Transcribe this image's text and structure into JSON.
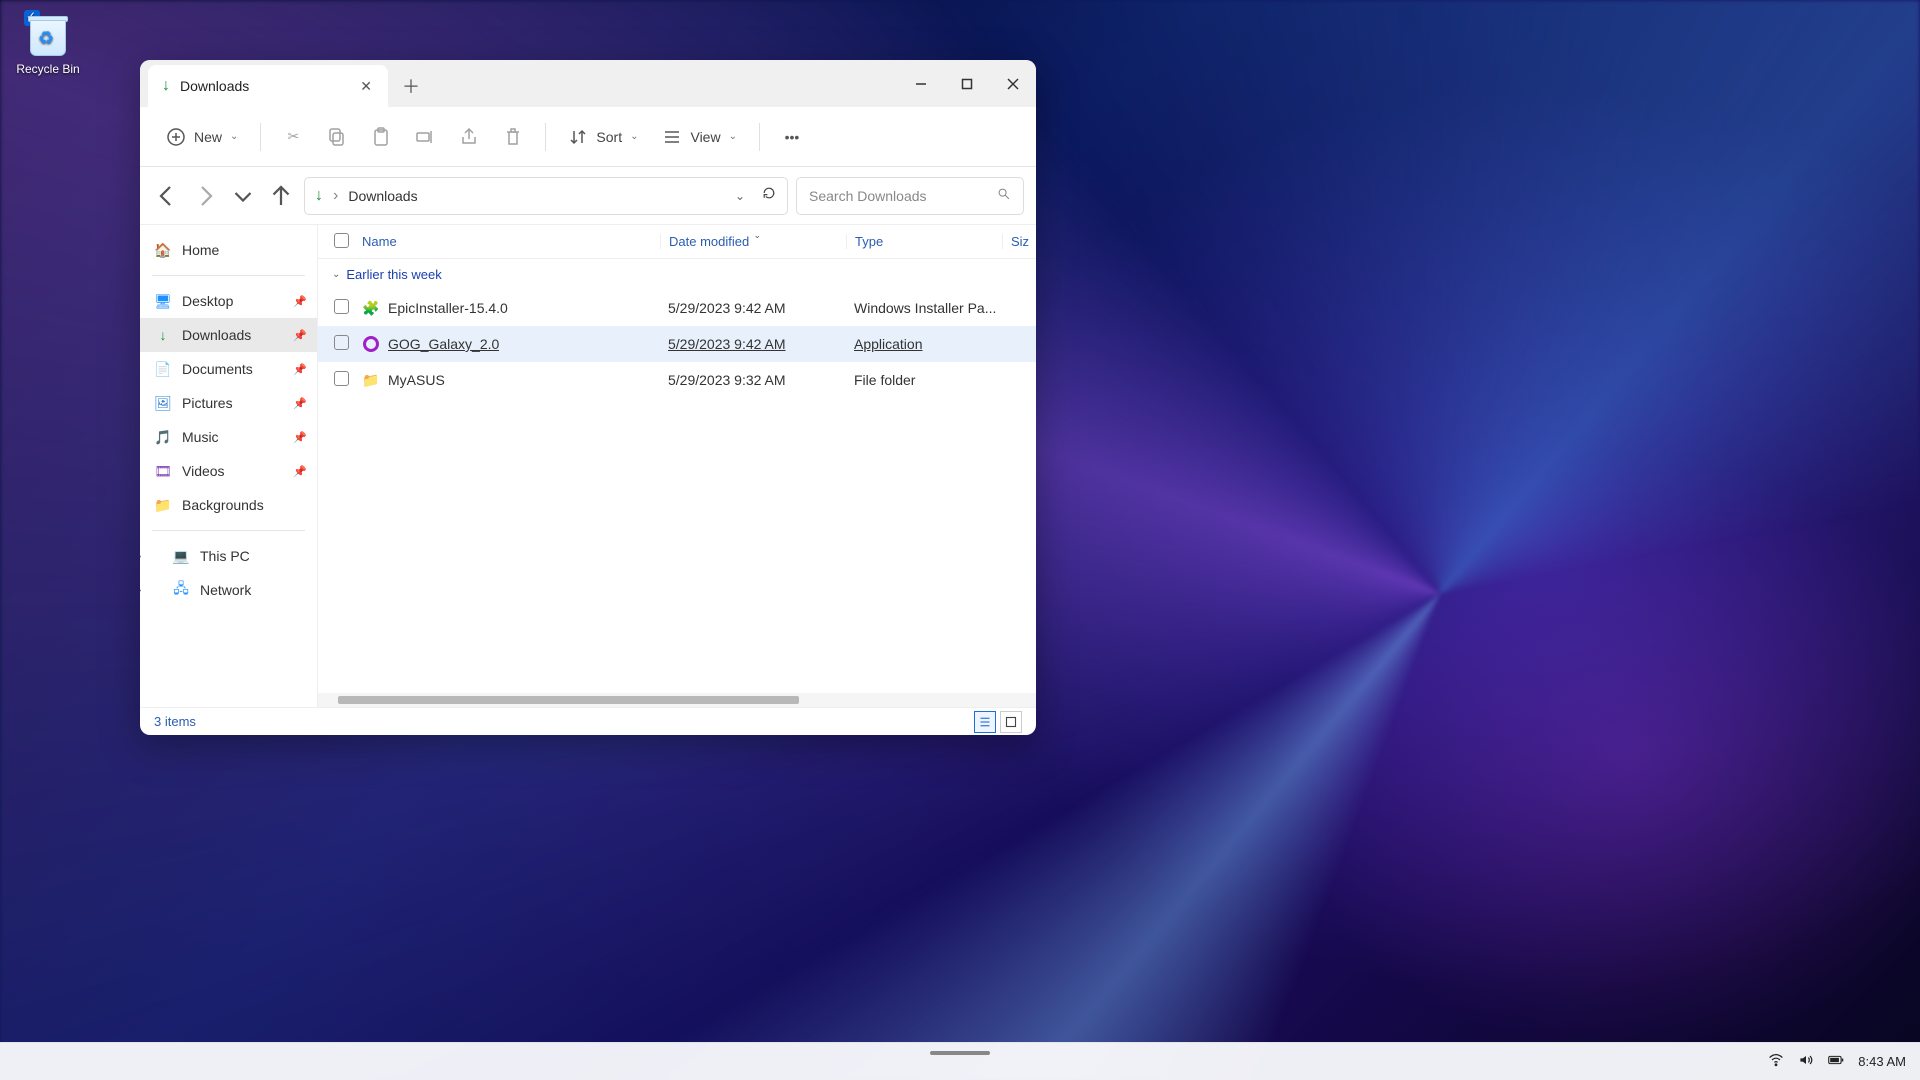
{
  "desktop": {
    "recycle_bin": "Recycle Bin"
  },
  "window": {
    "tab_title": "Downloads",
    "toolbar": {
      "new": "New",
      "sort": "Sort",
      "view": "View"
    },
    "address": {
      "location": "Downloads"
    },
    "search": {
      "placeholder": "Search Downloads"
    },
    "sidebar": {
      "home": "Home",
      "desktop": "Desktop",
      "downloads": "Downloads",
      "documents": "Documents",
      "pictures": "Pictures",
      "music": "Music",
      "videos": "Videos",
      "backgrounds": "Backgrounds",
      "this_pc": "This PC",
      "network": "Network"
    },
    "columns": {
      "name": "Name",
      "date": "Date modified",
      "type": "Type",
      "size": "Siz"
    },
    "group": "Earlier this week",
    "files": [
      {
        "name": "EpicInstaller-15.4.0",
        "date": "5/29/2023 9:42 AM",
        "type": "Windows Installer Pa...",
        "icon": "installer"
      },
      {
        "name": "GOG_Galaxy_2.0",
        "date": "5/29/2023 9:42 AM",
        "type": "Application",
        "icon": "gog",
        "hover": true
      },
      {
        "name": "MyASUS",
        "date": "5/29/2023 9:32 AM",
        "type": "File folder",
        "icon": "folder"
      }
    ],
    "status": "3 items"
  },
  "taskbar": {
    "clock": "8:43 AM"
  }
}
